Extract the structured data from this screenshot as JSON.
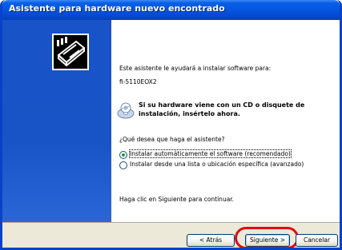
{
  "window": {
    "title": "Asistente para hardware nuevo encontrado"
  },
  "content": {
    "intro": "Este asistente le ayudará a instalar software para:",
    "device": "fi-5110EOX2",
    "cd_message": "Si su hardware viene con un CD o disquete de instalación, insértelo ahora.",
    "question": "¿Qué desea que haga el asistente?",
    "options": [
      {
        "label": "Instalar automáticamente el software (recomendado)",
        "selected": true
      },
      {
        "label": "Instalar desde una lista o ubicación específica (avanzado)",
        "selected": false
      }
    ],
    "hint": "Haga clic en Siguiente para continuar."
  },
  "buttons": {
    "back": "< Atrás",
    "next": "Siguiente >",
    "cancel": "Cancelar"
  },
  "icons": {
    "wizard": "hardware-wizard-icon",
    "cd": "cd-disc-icon"
  },
  "colors": {
    "titlebar": "#0456e0",
    "sidebar": "#1853c8",
    "highlight": "#e30613",
    "radio_selected": "#21a121"
  }
}
